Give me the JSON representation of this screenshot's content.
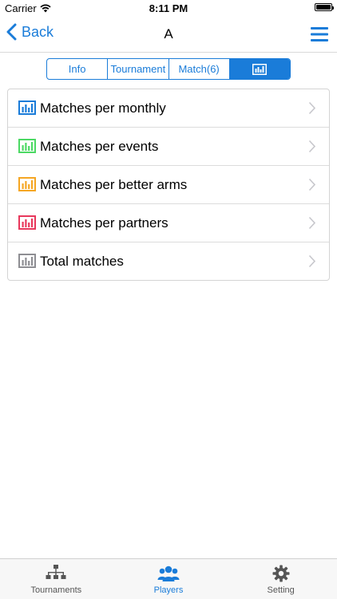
{
  "status_bar": {
    "carrier": "Carrier",
    "time": "8:11 PM"
  },
  "nav": {
    "back_label": "Back",
    "title": "A"
  },
  "segments": [
    {
      "label": "Info"
    },
    {
      "label": "Tournament"
    },
    {
      "label": "Match(6)"
    }
  ],
  "list": {
    "items": [
      {
        "label": "Matches per monthly",
        "icon_color": "#1a7cd9"
      },
      {
        "label": "Matches per events",
        "icon_color": "#4cd964"
      },
      {
        "label": "Matches per better arms",
        "icon_color": "#f5a623"
      },
      {
        "label": "Matches per partners",
        "icon_color": "#e8385c"
      },
      {
        "label": "Total matches",
        "icon_color": "#8e8e93"
      }
    ]
  },
  "tab_bar": {
    "items": [
      {
        "label": "Tournaments",
        "icon": "hierarchy-icon"
      },
      {
        "label": "Players",
        "icon": "players-icon"
      },
      {
        "label": "Setting",
        "icon": "gear-icon"
      }
    ]
  },
  "colors": {
    "accent": "#1a7cd9"
  }
}
